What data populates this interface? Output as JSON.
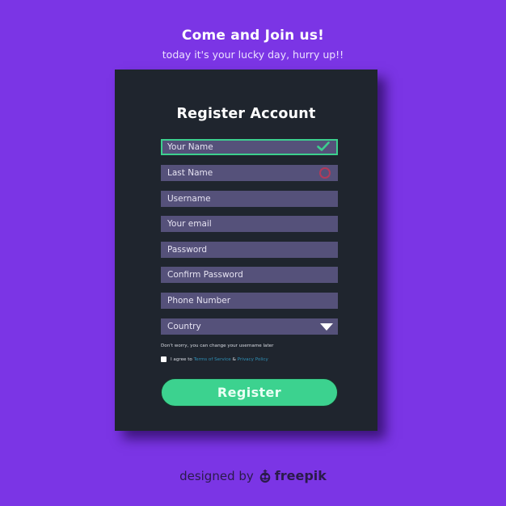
{
  "header": {
    "title": "Come and Join us!",
    "subtitle": "today it's your lucky day, hurry up!!"
  },
  "form": {
    "title": "Register Account",
    "fields": [
      {
        "placeholder": "Your Name",
        "state": "valid",
        "icon": "check-icon"
      },
      {
        "placeholder": "Last Name",
        "state": "error",
        "icon": "error-circle-icon"
      },
      {
        "placeholder": "Username",
        "state": "default"
      },
      {
        "placeholder": "Your email",
        "state": "default"
      },
      {
        "placeholder": "Password",
        "state": "default"
      },
      {
        "placeholder": "Confirm Password",
        "state": "default"
      },
      {
        "placeholder": "Phone Number",
        "state": "default"
      },
      {
        "placeholder": "Country",
        "state": "select",
        "icon": "caret-down-icon"
      }
    ],
    "hint": "Don't worry, you can change your username later",
    "agree": {
      "prefix": "I agree to",
      "terms_link": "Terms of Service",
      "joiner": "&",
      "privacy_link": "Privacy Policy",
      "checked": false
    },
    "submit_label": "Register"
  },
  "footer": {
    "designed_by": "designed by",
    "brand": "freepik"
  },
  "colors": {
    "background": "#7b35e5",
    "card": "#1f252e",
    "field": "#55517a",
    "accent": "#3cd28f",
    "error": "#b23a5a",
    "link": "#2f8fb5"
  }
}
